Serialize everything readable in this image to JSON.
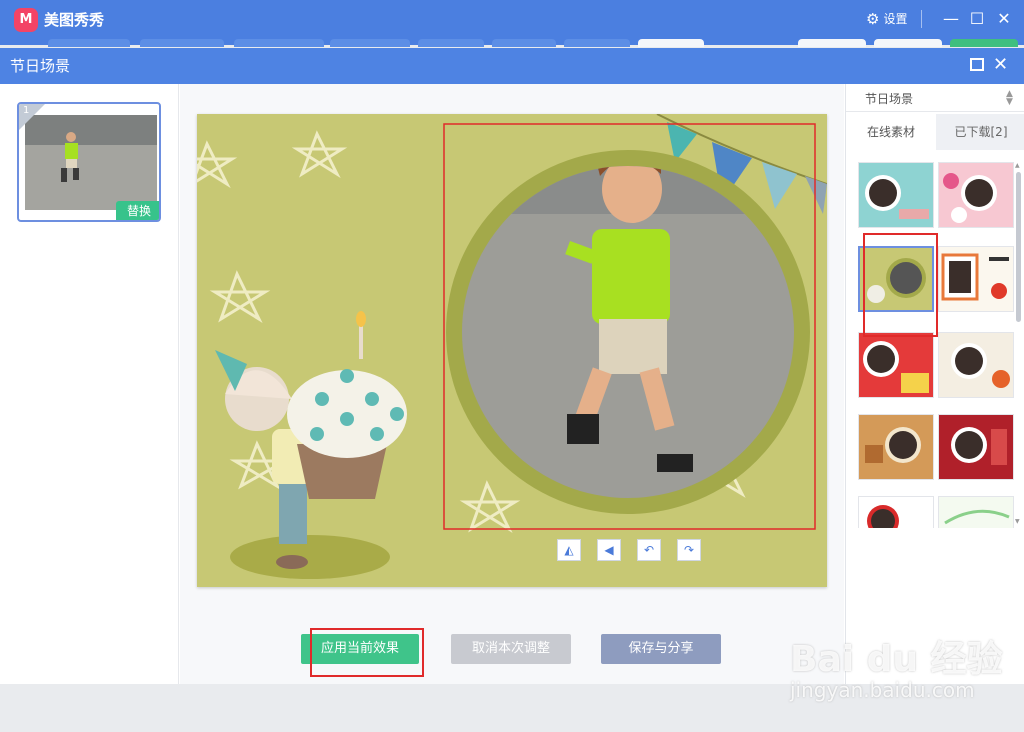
{
  "app": {
    "name": "美图秀秀",
    "logo_text": "M",
    "settings_label": "设置"
  },
  "dialog": {
    "title": "节日场景"
  },
  "left_panel": {
    "thumbnail_index": "1",
    "replace_label": "替换"
  },
  "canvas_tools": {
    "flip_horizontal": "◭",
    "flip_vertical": "◀",
    "rotate_left": "↶",
    "rotate_right": "↷"
  },
  "actions": {
    "apply_label": "应用当前效果",
    "cancel_label": "取消本次调整",
    "save_label": "保存与分享"
  },
  "right_panel": {
    "category": "节日场景",
    "tabs": [
      {
        "label": "在线素材",
        "active": true
      },
      {
        "label": "已下载[2]",
        "active": false
      }
    ]
  },
  "watermark": {
    "brand": "Bai du 经验",
    "url": "jingyan.baidu.com"
  },
  "colors": {
    "titlebar": "#4b7fe0",
    "dialog_header": "#4e83e3",
    "apply_green": "#3fc48a",
    "highlight_red": "#e02a2a",
    "canvas_bg": "#c7c874",
    "frame_ring": "#a3a94a"
  }
}
